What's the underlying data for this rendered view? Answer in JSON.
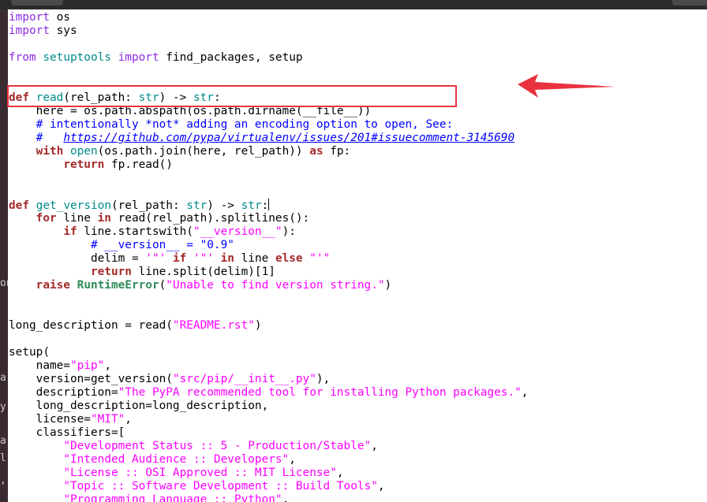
{
  "window": {
    "title": ""
  },
  "left_strip": [
    "on",
    "a",
    "y",
    "a",
    "l",
    ","
  ],
  "code_lines": [
    [
      {
        "t": "import",
        "c": "imp"
      },
      {
        "t": " os",
        "c": ""
      }
    ],
    [
      {
        "t": "import",
        "c": "imp"
      },
      {
        "t": " sys",
        "c": ""
      }
    ],
    [],
    [
      {
        "t": "from",
        "c": "imp"
      },
      {
        "t": " ",
        "c": ""
      },
      {
        "t": "setuptools",
        "c": "fn"
      },
      {
        "t": " ",
        "c": ""
      },
      {
        "t": "import",
        "c": "imp"
      },
      {
        "t": " find_packages, setup",
        "c": ""
      }
    ],
    [],
    [],
    [
      {
        "t": "def",
        "c": "kw-o"
      },
      {
        "t": " ",
        "c": ""
      },
      {
        "t": "read",
        "c": "fn"
      },
      {
        "t": "(rel_path: ",
        "c": ""
      },
      {
        "t": "str",
        "c": "ty"
      },
      {
        "t": ") -> ",
        "c": ""
      },
      {
        "t": "str",
        "c": "ty"
      },
      {
        "t": ":",
        "c": ""
      }
    ],
    [
      {
        "t": "    here = os.path.abspath(os.path.dirname(__file__))",
        "c": ""
      }
    ],
    [
      {
        "t": "    ",
        "c": ""
      },
      {
        "t": "# intentionally *not* adding an encoding option to open, See:",
        "c": "cm"
      }
    ],
    [
      {
        "t": "    ",
        "c": ""
      },
      {
        "t": "#   ",
        "c": "cm"
      },
      {
        "t": "https://github.com/pypa/virtualenv/issues/201#issuecomment-3145690",
        "c": "url"
      }
    ],
    [
      {
        "t": "    ",
        "c": ""
      },
      {
        "t": "with",
        "c": "kw"
      },
      {
        "t": " ",
        "c": ""
      },
      {
        "t": "open",
        "c": "fn"
      },
      {
        "t": "(os.path.join(here, rel_path)) ",
        "c": ""
      },
      {
        "t": "as",
        "c": "kw"
      },
      {
        "t": " fp:",
        "c": ""
      }
    ],
    [
      {
        "t": "        ",
        "c": ""
      },
      {
        "t": "return",
        "c": "kw"
      },
      {
        "t": " fp.read()",
        "c": ""
      }
    ],
    [],
    [],
    [
      {
        "t": "def",
        "c": "kw-o"
      },
      {
        "t": " ",
        "c": ""
      },
      {
        "t": "get_version",
        "c": "fn"
      },
      {
        "t": "(rel_path: ",
        "c": ""
      },
      {
        "t": "str",
        "c": "ty"
      },
      {
        "t": ") -> ",
        "c": ""
      },
      {
        "t": "str",
        "c": "ty"
      },
      {
        "t": ":",
        "c": ""
      },
      {
        "t": "",
        "c": "caret"
      }
    ],
    [
      {
        "t": "    ",
        "c": ""
      },
      {
        "t": "for",
        "c": "kw"
      },
      {
        "t": " line ",
        "c": ""
      },
      {
        "t": "in",
        "c": "kw"
      },
      {
        "t": " read(rel_path).splitlines():",
        "c": ""
      }
    ],
    [
      {
        "t": "        ",
        "c": ""
      },
      {
        "t": "if",
        "c": "kw"
      },
      {
        "t": " line.startswith(",
        "c": ""
      },
      {
        "t": "\"__version__\"",
        "c": "str"
      },
      {
        "t": "):",
        "c": ""
      }
    ],
    [
      {
        "t": "            ",
        "c": ""
      },
      {
        "t": "# __version__ = \"0.9\"",
        "c": "cm"
      }
    ],
    [
      {
        "t": "            delim = ",
        "c": ""
      },
      {
        "t": "'\"'",
        "c": "str"
      },
      {
        "t": " ",
        "c": ""
      },
      {
        "t": "if",
        "c": "kw"
      },
      {
        "t": " ",
        "c": ""
      },
      {
        "t": "'\"'",
        "c": "str"
      },
      {
        "t": " ",
        "c": ""
      },
      {
        "t": "in",
        "c": "kw"
      },
      {
        "t": " line ",
        "c": ""
      },
      {
        "t": "else",
        "c": "kw"
      },
      {
        "t": " ",
        "c": ""
      },
      {
        "t": "\"'\"",
        "c": "str"
      }
    ],
    [
      {
        "t": "            ",
        "c": ""
      },
      {
        "t": "return",
        "c": "kw"
      },
      {
        "t": " line.split(delim)[1]",
        "c": ""
      }
    ],
    [
      {
        "t": "    ",
        "c": ""
      },
      {
        "t": "raise",
        "c": "kw"
      },
      {
        "t": " ",
        "c": ""
      },
      {
        "t": "RuntimeError",
        "c": "bi"
      },
      {
        "t": "(",
        "c": ""
      },
      {
        "t": "\"Unable to find version string.\"",
        "c": "str"
      },
      {
        "t": ")",
        "c": ""
      }
    ],
    [],
    [],
    [
      {
        "t": "long_description = read(",
        "c": ""
      },
      {
        "t": "\"README.rst\"",
        "c": "str"
      },
      {
        "t": ")",
        "c": ""
      }
    ],
    [],
    [
      {
        "t": "setup(",
        "c": ""
      }
    ],
    [
      {
        "t": "    name=",
        "c": ""
      },
      {
        "t": "\"pip\"",
        "c": "str"
      },
      {
        "t": ",",
        "c": ""
      }
    ],
    [
      {
        "t": "    version=get_version(",
        "c": ""
      },
      {
        "t": "\"src/pip/__init__.py\"",
        "c": "str"
      },
      {
        "t": "),",
        "c": ""
      }
    ],
    [
      {
        "t": "    description=",
        "c": ""
      },
      {
        "t": "\"The PyPA recommended tool for installing Python packages.\"",
        "c": "str"
      },
      {
        "t": ",",
        "c": ""
      }
    ],
    [
      {
        "t": "    long_description=long_description,",
        "c": ""
      }
    ],
    [
      {
        "t": "    license=",
        "c": ""
      },
      {
        "t": "\"MIT\"",
        "c": "str"
      },
      {
        "t": ",",
        "c": ""
      }
    ],
    [
      {
        "t": "    classifiers=[",
        "c": ""
      }
    ],
    [
      {
        "t": "        ",
        "c": ""
      },
      {
        "t": "\"Development Status :: 5 - Production/Stable\"",
        "c": "str"
      },
      {
        "t": ",",
        "c": ""
      }
    ],
    [
      {
        "t": "        ",
        "c": ""
      },
      {
        "t": "\"Intended Audience :: Developers\"",
        "c": "str"
      },
      {
        "t": ",",
        "c": ""
      }
    ],
    [
      {
        "t": "        ",
        "c": ""
      },
      {
        "t": "\"License :: OSI Approved :: MIT License\"",
        "c": "str"
      },
      {
        "t": ",",
        "c": ""
      }
    ],
    [
      {
        "t": "        ",
        "c": ""
      },
      {
        "t": "\"Topic :: Software Development :: Build Tools\"",
        "c": "str"
      },
      {
        "t": ",",
        "c": ""
      }
    ],
    [
      {
        "t": "        ",
        "c": ""
      },
      {
        "t": "\"Programming Language :: Python\"",
        "c": "str"
      },
      {
        "t": ",",
        "c": ""
      }
    ]
  ],
  "colors": {
    "keyword": "#a52a2a",
    "import": "#8a2be2",
    "function": "#008b8b",
    "string": "#ff00ff",
    "comment": "#0000ff",
    "builtin": "#2e8b57",
    "annotation": "#e8333f"
  },
  "annotations": {
    "highlight_box": "red-rectangle",
    "pointer": "red-arrow-icon"
  }
}
